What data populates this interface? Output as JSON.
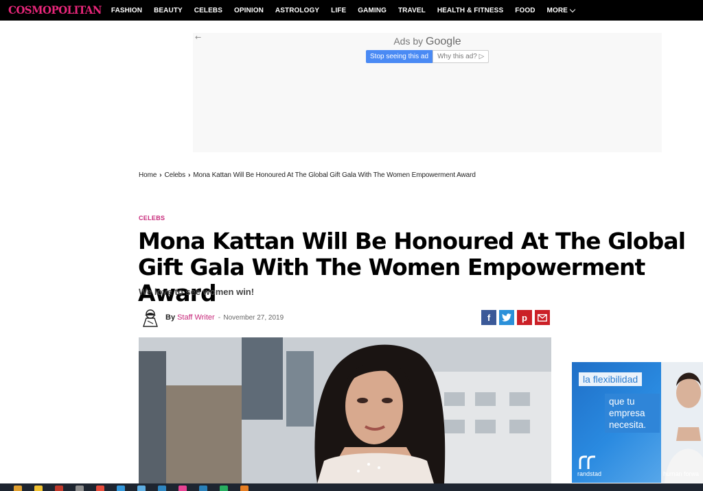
{
  "site": {
    "logo": "COSMOPOLITAN",
    "nav": [
      "FASHION",
      "BEAUTY",
      "CELEBS",
      "OPINION",
      "ASTROLOGY",
      "LIFE",
      "GAMING",
      "TRAVEL",
      "HEALTH & FITNESS",
      "FOOD"
    ],
    "more": "MORE"
  },
  "ad": {
    "ads_by": "Ads by",
    "google": "Google",
    "stop": "Stop seeing this ad",
    "why": "Why this ad? ▷"
  },
  "breadcrumb": {
    "home": "Home",
    "section": "Celebs",
    "current": "Mona Kattan Will Be Honoured At The Global Gift Gala With The Women Empowerment Award"
  },
  "article": {
    "category": "CELEBS",
    "title": "Mona Kattan Will Be Honoured At The Global Gift Gala With The Women Empowerment Award",
    "subtitle": "We love to see women win!",
    "by": "By",
    "author": "Staff Writer",
    "date": "November 27, 2019"
  },
  "share": {
    "facebook": "f",
    "twitter": "t",
    "pinterest": "p",
    "email": "✉"
  },
  "side_ad": {
    "tagline": "la flexibilidad",
    "message": "que tu empresa necesita.",
    "brand": "randstad",
    "slogan": "human forwa"
  },
  "colors": {
    "brand_pink": "#e8267a",
    "facebook": "#3b5998",
    "twitter": "#2b90d9",
    "pinterest": "#cb2027"
  }
}
